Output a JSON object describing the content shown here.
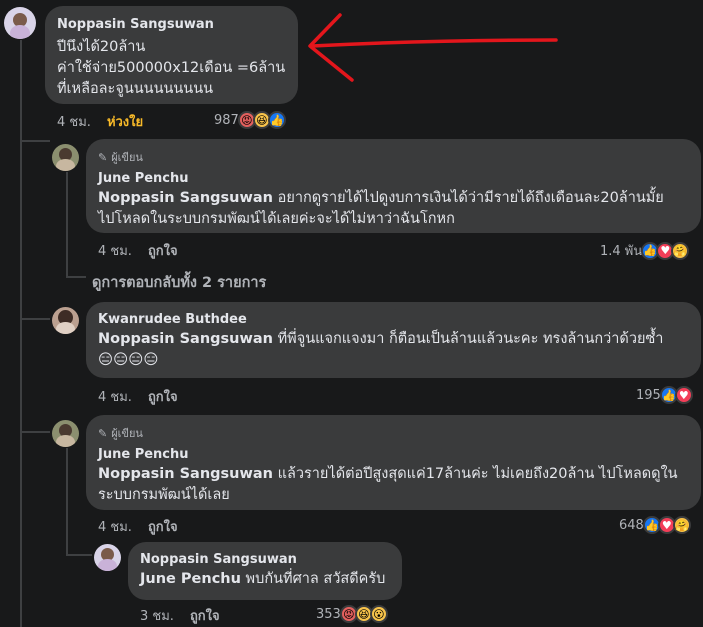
{
  "colors": {
    "background": "#18191a",
    "bubble": "#3a3b3c",
    "text": "#e4e6eb",
    "muted": "#b0b3b8",
    "care_active": "#f7b928",
    "annotation": "#e3161c"
  },
  "comments": [
    {
      "name": "Noppasin Sangsuwan",
      "lines": "ปีนึงได้20ล้าน\nค่าใช้จ่าย500000x12เดือน =6ล้าน\nที่เหลือละจูนนนนนนนนน",
      "time": "4 ชม.",
      "like_label": "ห่วงใย",
      "reaction_count": "987",
      "reactions": [
        "angry-icon",
        "haha-icon",
        "like-icon"
      ]
    },
    {
      "badge": "ผู้เขียน",
      "name": "June Penchu",
      "mention": "Noppasin Sangsuwan",
      "text": " อยากดูรายได้ไปดูงบการเงินได้ว่ามีรายได้ถึงเดือนละ20ล้านมั้ย\nไปโหลดในระบบกรมพัฒน์ได้เลยค่ะจะได้ไม่หาว่าฉันโกหก",
      "time": "4 ชม.",
      "like_label": "ถูกใจ",
      "reaction_count": "1.4 พัน",
      "reactions": [
        "like-icon",
        "love-icon",
        "care-icon"
      ]
    },
    {
      "view_replies": "ดูการตอบกลับทั้ง 2 รายการ"
    },
    {
      "name": "Kwanrudee Buthdee",
      "mention": "Noppasin Sangsuwan",
      "text": " ที่พี่จูนแจกแจงมา ก็ตือนเป็นล้านแล้วนะคะ ทรงล้านกว่าด้วยซ้ำ",
      "emoji_line": "😑😑😑😑",
      "time": "4 ชม.",
      "like_label": "ถูกใจ",
      "reaction_count": "195",
      "reactions": [
        "like-icon",
        "love-icon"
      ]
    },
    {
      "badge": "ผู้เขียน",
      "name": "June Penchu",
      "mention": "Noppasin Sangsuwan",
      "text": " แล้วรายได้ต่อปีสูงสุดแค่17ล้านค่ะ ไม่เคยถึง20ล้าน ไปโหลดดูใน\nระบบกรมพัฒน์ได้เลย",
      "time": "4 ชม.",
      "like_label": "ถูกใจ",
      "reaction_count": "648",
      "reactions": [
        "like-icon",
        "love-icon",
        "care-icon"
      ]
    },
    {
      "name": "Noppasin Sangsuwan",
      "mention": "June Penchu",
      "text": " พบกันที่ศาล สวัสดีครับ",
      "time": "3 ชม.",
      "like_label": "ถูกใจ",
      "reaction_count": "353",
      "reactions": [
        "angry-icon",
        "haha-icon",
        "wow-icon"
      ]
    }
  ]
}
